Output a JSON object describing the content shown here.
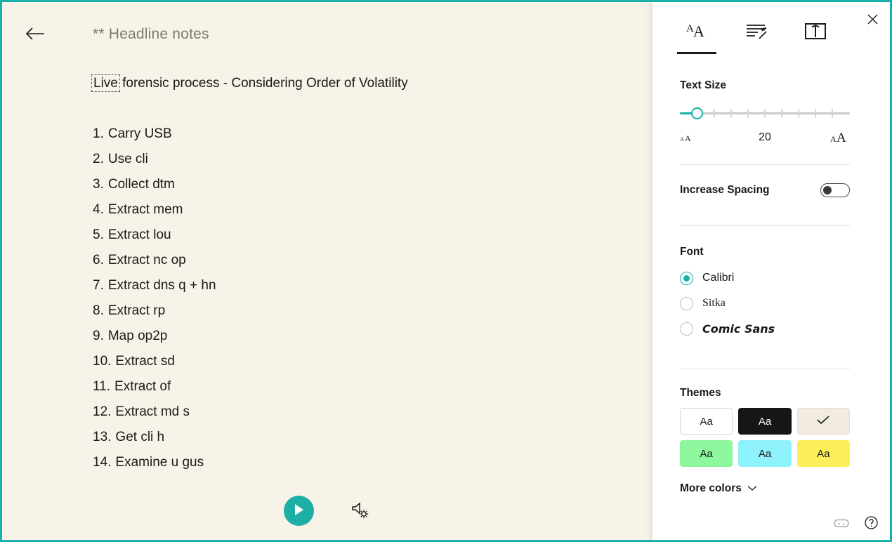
{
  "window": {
    "border_color": "#18b0a8",
    "accent_color": "#1bafa5"
  },
  "reader": {
    "back_icon": "back-arrow-icon",
    "title": "** Headline notes",
    "background_color": "#f7f3e8",
    "lead_line": {
      "highlighted_word": "Live",
      "rest": " forensic process - Considering Order of Volatility"
    },
    "list_items": [
      {
        "num": "1.",
        "text": "Carry USB"
      },
      {
        "num": "2.",
        "text": "Use cli"
      },
      {
        "num": "3.",
        "text": "Collect dtm"
      },
      {
        "num": "4.",
        "text": "Extract mem"
      },
      {
        "num": "5.",
        "text": "Extract lou"
      },
      {
        "num": "6.",
        "text": "Extract nc op"
      },
      {
        "num": "7.",
        "text": "Extract dns q + hn"
      },
      {
        "num": "8.",
        "text": "Extract rp"
      },
      {
        "num": "9.",
        "text": "Map op2p"
      },
      {
        "num": "10.",
        "text": "Extract sd"
      },
      {
        "num": "11.",
        "text": "Extract of"
      },
      {
        "num": "12.",
        "text": "Extract md s"
      },
      {
        "num": "13.",
        "text": "Get cli h"
      },
      {
        "num": "14.",
        "text": "Examine u gus"
      }
    ],
    "controls": {
      "play_icon": "play-icon",
      "voice_settings_icon": "speaker-gear-icon"
    }
  },
  "panel": {
    "close_icon": "close-icon",
    "tabs": [
      {
        "name": "text-preferences",
        "icon": "text-size-aa-icon",
        "active": true
      },
      {
        "name": "grammar-options",
        "icon": "lines-wand-icon",
        "active": false
      },
      {
        "name": "reading-preferences",
        "icon": "open-book-icon",
        "active": false
      }
    ],
    "text_size": {
      "title": "Text Size",
      "value": "20",
      "small_icon": "small-aa-icon",
      "large_icon": "large-aa-icon",
      "tick_count": 8
    },
    "spacing": {
      "label": "Increase Spacing",
      "state": "off"
    },
    "font": {
      "title": "Font",
      "options": [
        {
          "label": "Calibri",
          "selected": true
        },
        {
          "label": "Sitka",
          "selected": false
        },
        {
          "label": "Comic Sans",
          "selected": false
        }
      ]
    },
    "themes": {
      "title": "Themes",
      "swatches": [
        {
          "label": "Aa",
          "bg": "#ffffff",
          "fg": "#1a1a1a",
          "border": "#d9d9d9",
          "selected": false
        },
        {
          "label": "Aa",
          "bg": "#161616",
          "fg": "#ffffff",
          "border": "#161616",
          "selected": false
        },
        {
          "label": "",
          "bg": "#f2ece0",
          "fg": "#1a1a1a",
          "border": "#e6dfd1",
          "selected": true
        },
        {
          "label": "Aa",
          "bg": "#8cf79c",
          "fg": "#1a1a1a",
          "border": "#8cf79c",
          "selected": false
        },
        {
          "label": "Aa",
          "bg": "#8df2fb",
          "fg": "#1a1a1a",
          "border": "#8df2fb",
          "selected": false
        },
        {
          "label": "Aa",
          "bg": "#fcee59",
          "fg": "#1a1a1a",
          "border": "#fcee59",
          "selected": false
        }
      ],
      "more_colors_label": "More colors",
      "more_colors_icon": "chevron-down-icon"
    },
    "footer": [
      {
        "name": "feedback-icon"
      },
      {
        "name": "help-icon"
      }
    ]
  }
}
